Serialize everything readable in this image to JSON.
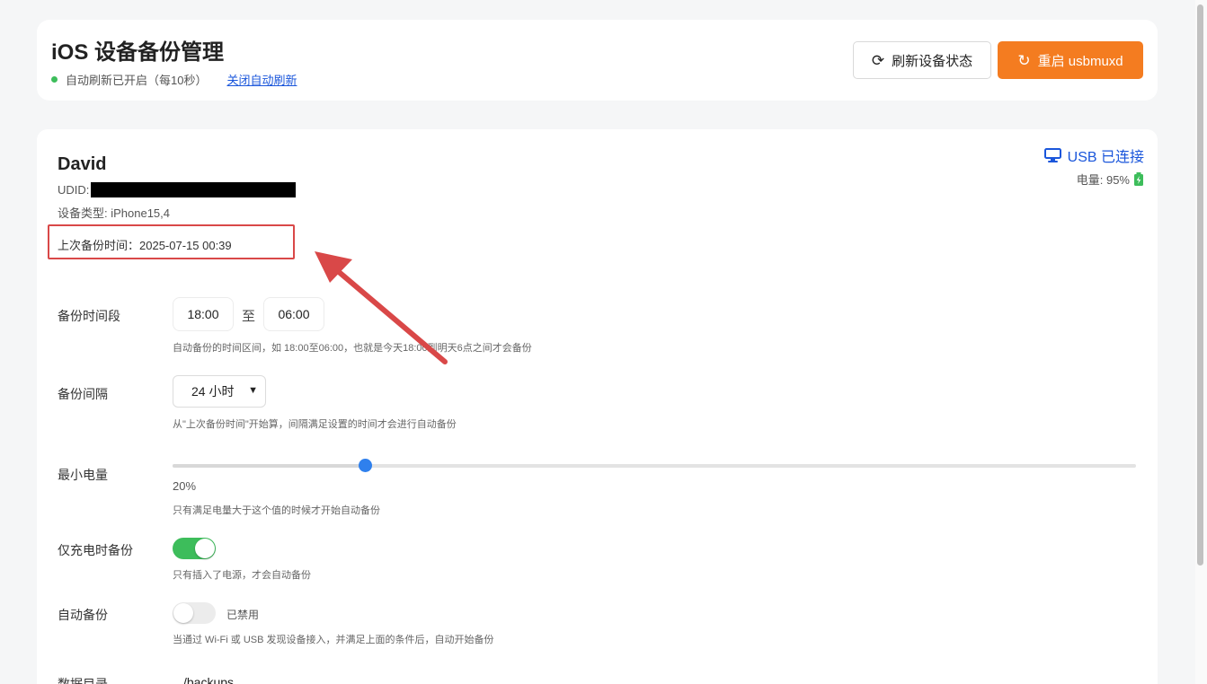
{
  "header": {
    "title": "iOS 设备备份管理",
    "auto_refresh_text": "自动刷新已开启（每10秒）",
    "auto_refresh_toggle": "关闭自动刷新",
    "refresh_button": "刷新设备状态",
    "restart_button": "重启 usbmuxd",
    "status_color": "#3dbd5b",
    "accent_color": "#f47c20"
  },
  "device": {
    "name": "David",
    "udid_label": "UDID:",
    "type_label": "设备类型: iPhone15,4",
    "last_backup": "上次备份时间：2025-07-15 00:39",
    "connection": "USB 已连接",
    "battery_label": "电量: 95%",
    "battery_icon": "battery-charging-icon",
    "connection_icon": "monitor-icon"
  },
  "settings": {
    "time_window": {
      "label": "备份时间段",
      "start": "18:00",
      "separator": "至",
      "end": "06:00",
      "help": "自动备份的时间区间，如 18:00至06:00，也就是今天18:00到明天6点之间才会备份"
    },
    "interval": {
      "label": "备份间隔",
      "value": "24 小时",
      "help": "从\"上次备份时间\"开始算，间隔满足设置的时间才会进行自动备份"
    },
    "min_battery": {
      "label": "最小电量",
      "value_text": "20%",
      "fraction": 0.2,
      "help": "只有满足电量大于这个值的时候才开始自动备份"
    },
    "charging_only": {
      "label": "仅充电时备份",
      "enabled": true,
      "help": "只有插入了电源，才会自动备份"
    },
    "auto_backup": {
      "label": "自动备份",
      "enabled": false,
      "state_text": "已禁用",
      "help": "当通过 Wi-Fi 或 USB 发现设备接入，并满足上面的条件后，自动开始备份"
    },
    "data_dir": {
      "label": "数据目录",
      "value": "/backups"
    }
  },
  "annotation": {
    "highlight_color": "#d94848"
  }
}
